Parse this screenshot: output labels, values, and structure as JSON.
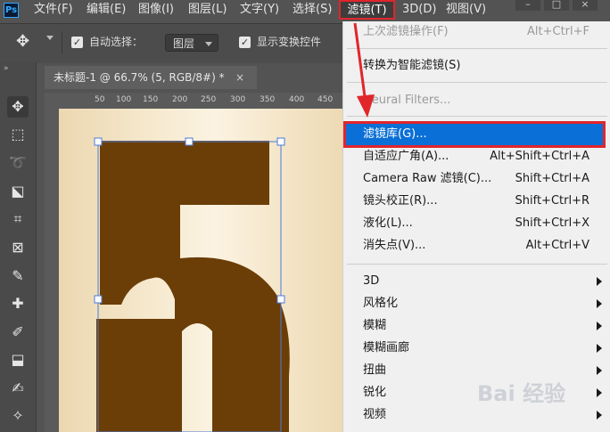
{
  "app": {
    "logo": "Ps"
  },
  "menubar": {
    "items": [
      "文件(F)",
      "编辑(E)",
      "图像(I)",
      "图层(L)",
      "文字(Y)",
      "选择(S)"
    ],
    "active": "滤镜(T)",
    "after": [
      "3D(D)",
      "视图(V)"
    ]
  },
  "options": {
    "auto_select_label": "自动选择：",
    "auto_select_value": "图层",
    "show_transform_label": "显示变换控件"
  },
  "document": {
    "tab_title": "未标题-1 @ 66.7% (5, RGB/8#) *",
    "close": "×",
    "ruler_ticks": [
      "50",
      "100",
      "150",
      "200",
      "250",
      "300",
      "350",
      "400",
      "450"
    ],
    "canvas_text": "5"
  },
  "filter_menu": {
    "items": [
      {
        "label": "上次滤镜操作(F)",
        "shortcut": "Alt+Ctrl+F",
        "disabled": true
      },
      {
        "label": "转换为智能滤镜(S)",
        "shortcut": ""
      },
      {
        "label": "Neural Filters...",
        "shortcut": "",
        "disabled": true
      },
      {
        "label": "滤镜库(G)...",
        "shortcut": "",
        "highlighted": true
      },
      {
        "label": "自适应广角(A)...",
        "shortcut": "Alt+Shift+Ctrl+A"
      },
      {
        "label": "Camera Raw 滤镜(C)...",
        "shortcut": "Shift+Ctrl+A"
      },
      {
        "label": "镜头校正(R)...",
        "shortcut": "Shift+Ctrl+R"
      },
      {
        "label": "液化(L)...",
        "shortcut": "Shift+Ctrl+X"
      },
      {
        "label": "消失点(V)...",
        "shortcut": "Alt+Ctrl+V"
      }
    ],
    "submenus": [
      "3D",
      "风格化",
      "模糊",
      "模糊画廊",
      "扭曲",
      "锐化",
      "视频"
    ]
  },
  "watermark": {
    "text": "Bai 经验"
  },
  "colors": {
    "highlight": "#0a6fd6",
    "annotation_red": "#e0252b",
    "glyph_brown": "#6b3d07"
  }
}
